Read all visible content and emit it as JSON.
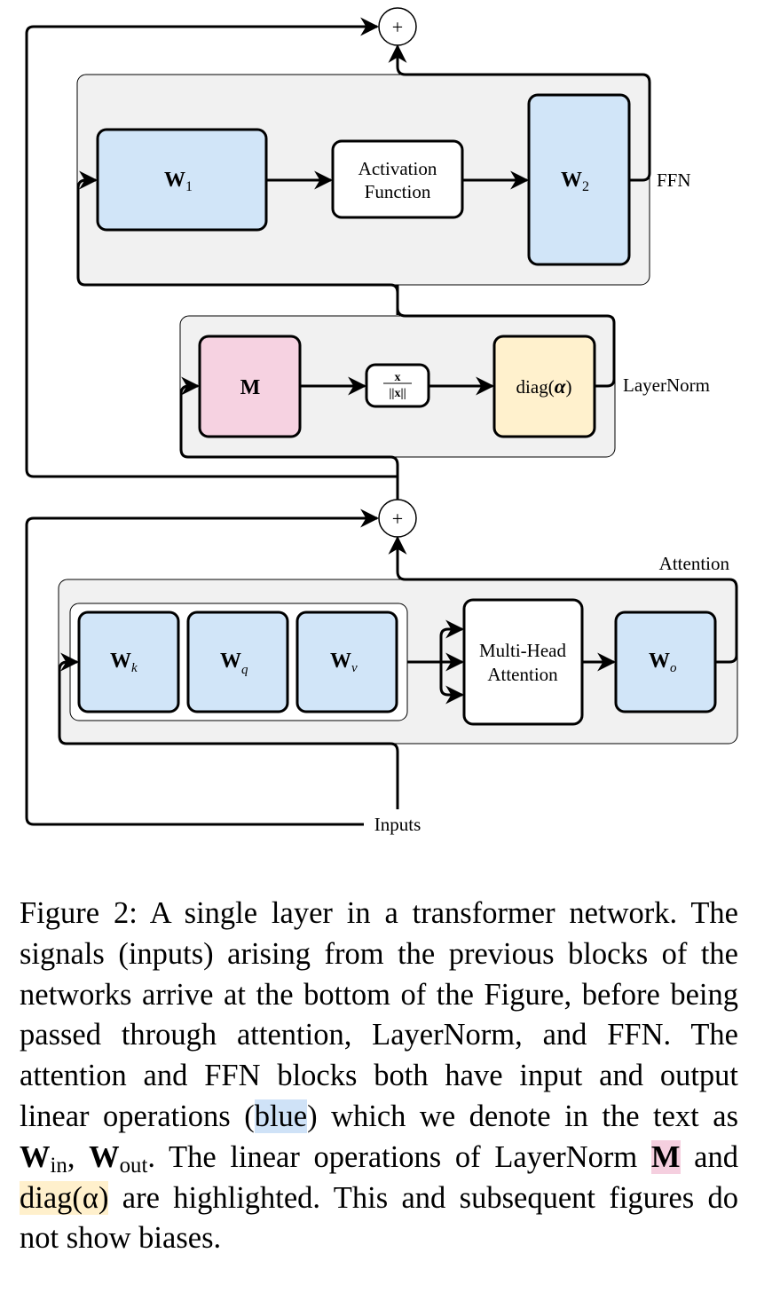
{
  "colors": {
    "linear_blue": "#d1e5f8",
    "layernorm_M_pink": "#f6d2e1",
    "layernorm_diag_yellow": "#fff1cd",
    "block_bg_gray": "#f1f1f1",
    "stroke": "#000000"
  },
  "diagram": {
    "ffn": {
      "label": "FFN",
      "w1": {
        "base": "W",
        "sub": "1"
      },
      "activation": [
        "Activation",
        "Function"
      ],
      "w2": {
        "base": "W",
        "sub": "2"
      }
    },
    "layernorm": {
      "label": "LayerNorm",
      "m": "M",
      "norm": {
        "num": "x",
        "den": "||x||"
      },
      "diag": {
        "prefix": "diag(",
        "sym": "α",
        "suffix": ")"
      }
    },
    "attention": {
      "label": "Attention",
      "wk": {
        "base": "W",
        "sub": "k"
      },
      "wq": {
        "base": "W",
        "sub": "q"
      },
      "wv": {
        "base": "W",
        "sub": "v"
      },
      "mha": [
        "Multi-Head",
        "Attention"
      ],
      "wo": {
        "base": "W",
        "sub": "o"
      }
    },
    "adder_symbol": "+",
    "inputs_label": "Inputs"
  },
  "caption": {
    "p1": "Figure 2:  A single layer in a transformer network. The signals (inputs) arising from the previous blocks of the networks arrive at the bottom of the Figure, before being passed through attention, LayerNorm, and FFN. The attention and FFN blocks both have input and output linear operations (",
    "blue": "blue",
    "p2": ") which we denote in the text as ",
    "w": "W",
    "in": "in",
    "comma": ", ",
    "out": "out",
    "p3": ". The linear operations of LayerNorm ",
    "m": "M",
    "p4": " and ",
    "diag": "diag(α)",
    "p5": " are highlighted. This and subsequent figures do not show biases."
  }
}
